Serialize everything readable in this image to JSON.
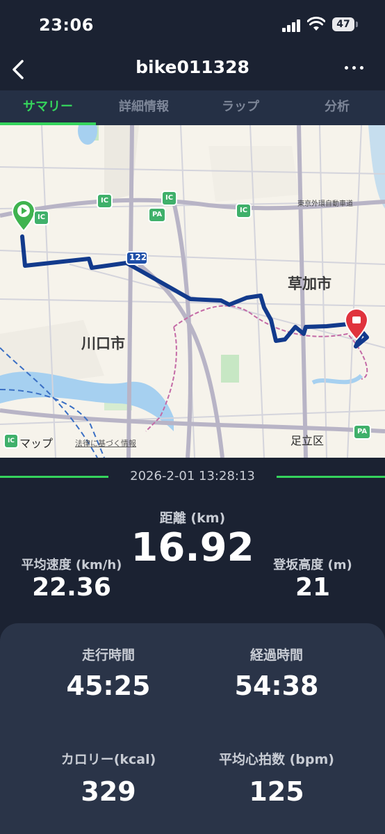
{
  "status": {
    "time": "23:06",
    "battery": "47"
  },
  "header": {
    "title": "bike011328"
  },
  "tabs": [
    {
      "label": "サマリー",
      "active": true
    },
    {
      "label": "詳細情報",
      "active": false
    },
    {
      "label": "ラップ",
      "active": false
    },
    {
      "label": "分析",
      "active": false
    }
  ],
  "map": {
    "labels": {
      "soka": "草加市",
      "kawaguchi": "川口市",
      "adachi": "足立区",
      "expressway": "東京外環自動車道",
      "route": "122",
      "apple_maps": "マップ",
      "legal": "法律に基づく情報"
    },
    "badges": {
      "ic": "IC",
      "pa": "PA"
    },
    "colors": {
      "route": "#123a8c",
      "start": "#3fb34f",
      "end": "#e0333d"
    }
  },
  "datetime": "2026-2-01 13:28:13",
  "summary": {
    "distance": {
      "label": "距離 (km)",
      "value": "16.92"
    },
    "avg_speed": {
      "label": "平均速度 (km/h)",
      "value": "22.36"
    },
    "climb": {
      "label": "登坂高度 (m)",
      "value": "21"
    },
    "moving_time": {
      "label": "走行時間",
      "value": "45:25"
    },
    "elapsed_time": {
      "label": "経過時間",
      "value": "54:38"
    },
    "calories": {
      "label": "カロリー(kcal)",
      "value": "329"
    },
    "avg_hr": {
      "label": "平均心拍数 (bpm)",
      "value": "125"
    }
  },
  "theme": {
    "accent": "#35d45c",
    "background": "#1b2232",
    "card": "#2a3448"
  }
}
